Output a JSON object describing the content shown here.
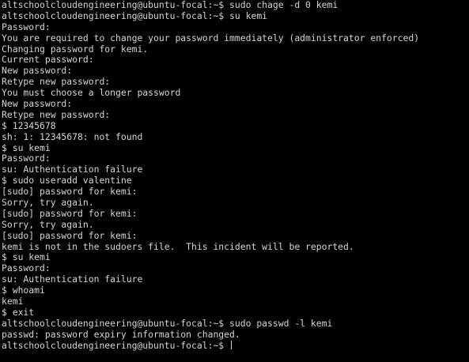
{
  "terminal": {
    "lines": [
      "altschoolcloudengineering@ubuntu-focal:~$ sudo chage -d 0 kemi",
      "altschoolcloudengineering@ubuntu-focal:~$ su kemi",
      "Password:",
      "You are required to change your password immediately (administrator enforced)",
      "Changing password for kemi.",
      "Current password:",
      "New password:",
      "Retype new password:",
      "You must choose a longer password",
      "New password:",
      "Retype new password:",
      "$ 12345678",
      "sh: 1: 12345678: not found",
      "$ su kemi",
      "Password:",
      "su: Authentication failure",
      "$ sudo useradd valentine",
      "[sudo] password for kemi:",
      "Sorry, try again.",
      "[sudo] password for kemi:",
      "Sorry, try again.",
      "[sudo] password for kemi:",
      "kemi is not in the sudoers file.  This incident will be reported.",
      "$ su kemi",
      "Password:",
      "su: Authentication failure",
      "$ whoami",
      "kemi",
      "$ exit",
      "altschoolcloudengineering@ubuntu-focal:~$ sudo passwd -l kemi",
      "passwd: password expiry information changed."
    ],
    "current_prompt": "altschoolcloudengineering@ubuntu-focal:~$ "
  },
  "colors": {
    "background": "#000000",
    "foreground": "#d4d4d4"
  }
}
